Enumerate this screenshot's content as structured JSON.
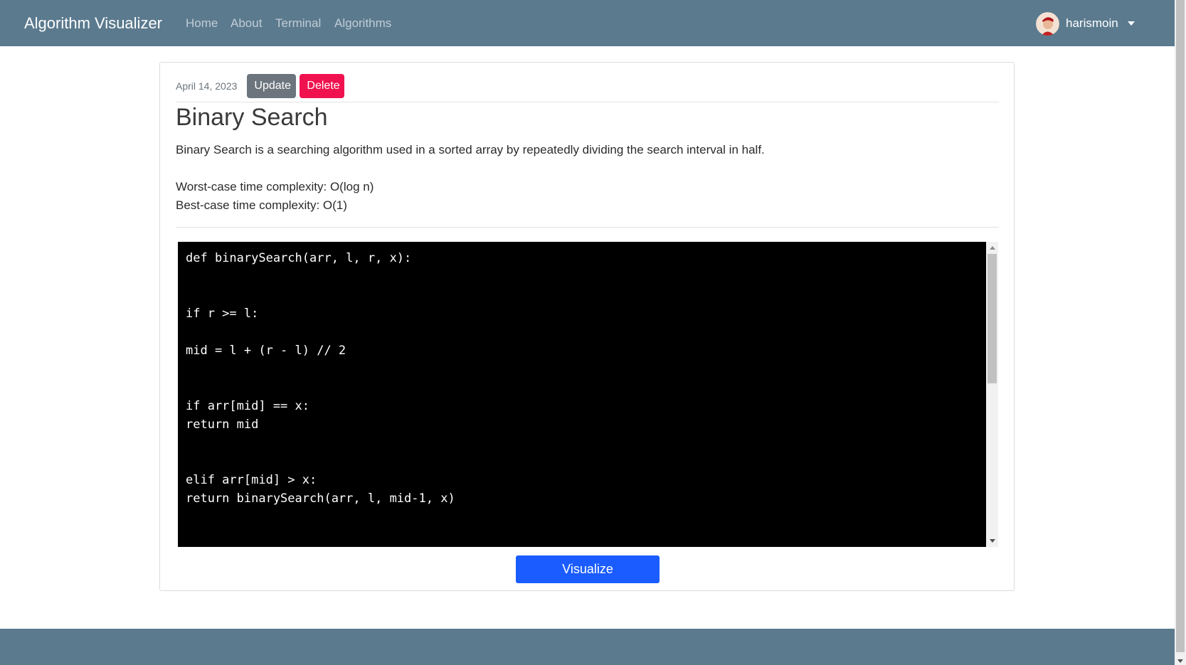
{
  "navbar": {
    "brand": "Algorithm Visualizer",
    "links": [
      "Home",
      "About",
      "Terminal",
      "Algorithms"
    ],
    "user": {
      "name": "harismoin"
    }
  },
  "post": {
    "date": "April 14, 2023",
    "update_label": "Update",
    "delete_label": "Delete",
    "title": "Binary Search",
    "description": "Binary Search is a searching algorithm used in a sorted array by repeatedly dividing the search interval in half.",
    "worst_case": "Worst-case time complexity: O(log n)",
    "best_case": "Best-case time complexity: O(1)"
  },
  "code": {
    "lines": [
      "def binarySearch(arr, l, r, x):",
      "",
      "",
      "if r >= l:",
      "",
      "mid = l + (r - l) // 2",
      "",
      "",
      "if arr[mid] == x:",
      "return mid",
      "",
      "",
      "elif arr[mid] > x:",
      "return binarySearch(arr, l, mid-1, x)"
    ]
  },
  "actions": {
    "visualize_label": "Visualize"
  },
  "colors": {
    "navbar": "#5b7a8e",
    "delete": "#f0124f",
    "update": "#6c757d",
    "primary": "#1a5cff",
    "code_bg": "#000000"
  }
}
